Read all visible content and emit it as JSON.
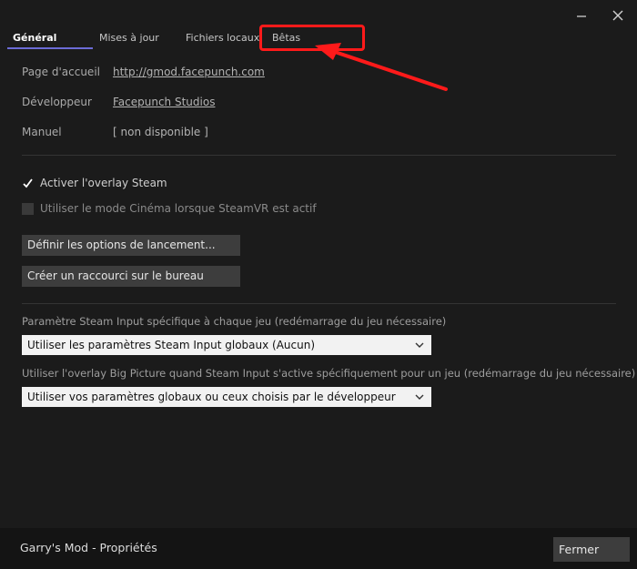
{
  "tabs": [
    {
      "label": "Général",
      "active": true
    },
    {
      "label": "Mises à jour",
      "active": false
    },
    {
      "label": "Fichiers locaux",
      "active": false
    },
    {
      "label": "Bêtas",
      "active": false
    }
  ],
  "info": {
    "homepage_label": "Page d'accueil",
    "homepage_value": "http://gmod.facepunch.com",
    "developer_label": "Développeur",
    "developer_value": "Facepunch Studios",
    "manual_label": "Manuel",
    "manual_value": "[ non disponible ]"
  },
  "checkboxes": {
    "overlay_label": "Activer l'overlay Steam",
    "overlay_checked": true,
    "cinema_label": "Utiliser le mode Cinéma lorsque SteamVR est actif",
    "cinema_checked": false
  },
  "buttons": {
    "launch_options": "Définir les options de lancement...",
    "desktop_shortcut": "Créer un raccourci sur le bureau"
  },
  "steam_input": {
    "label": "Paramètre Steam Input spécifique à chaque jeu (redémarrage du jeu nécessaire)",
    "selected": "Utiliser les paramètres Steam Input globaux (Aucun)"
  },
  "big_picture": {
    "label": "Utiliser l'overlay Big Picture quand Steam Input s'active spécifiquement pour un jeu (redémarrage du jeu nécessaire)",
    "selected": "Utiliser vos paramètres globaux ou ceux choisis par le développeur"
  },
  "footer": {
    "title": "Garry's Mod - Propriétés",
    "close_label": "Fermer"
  },
  "colors": {
    "background": "#1b1b1b",
    "tab_underline": "#6b6bd6",
    "highlight": "#ff1a1a"
  },
  "icons": {
    "minimize": "minimize-icon",
    "close": "close-icon",
    "checkmark": "checkmark-icon",
    "chevron": "chevron-down-icon",
    "annotation_arrow": "annotation-arrow-icon"
  }
}
